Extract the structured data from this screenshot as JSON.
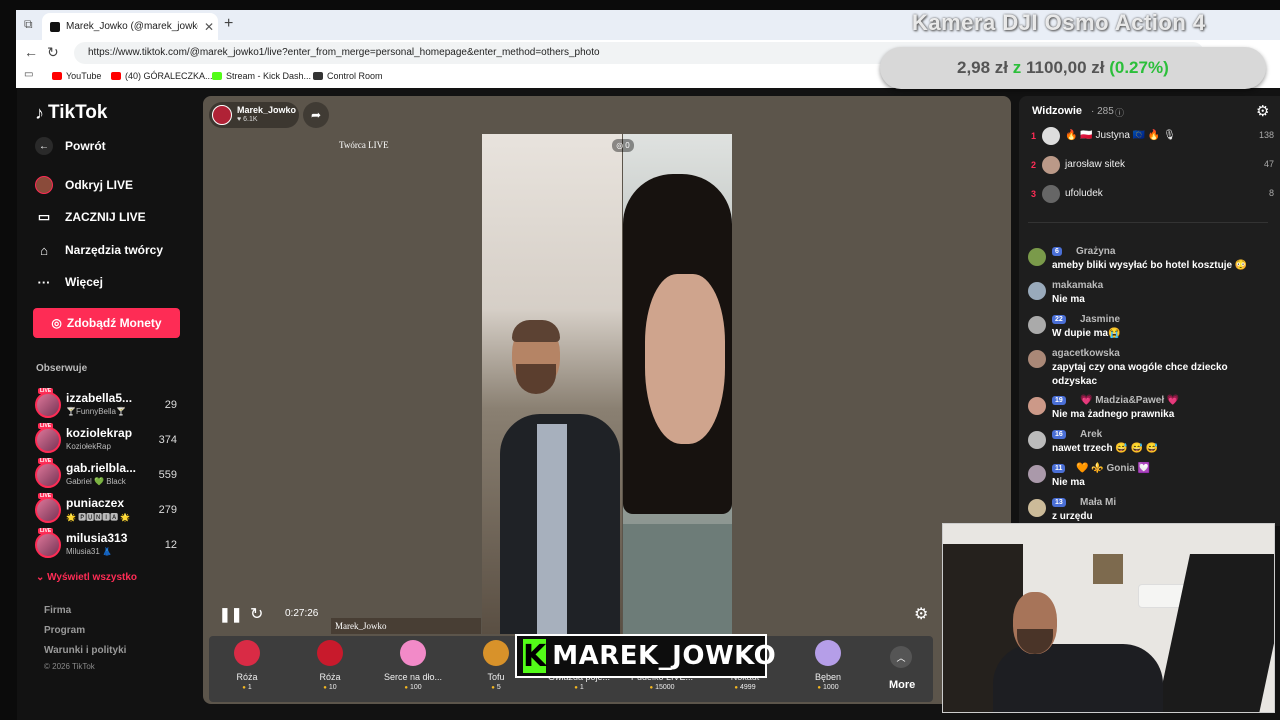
{
  "browser": {
    "tab_title": "Marek_Jowko (@marek_jowko1) p",
    "url": "https://www.tiktok.com/@marek_jowko1/live?enter_from_merge=personal_homepage&enter_method=others_photo",
    "bookmarks": [
      {
        "label": "YouTube",
        "color": "#ff0000"
      },
      {
        "label": "(40) GÓRALECZKA...",
        "color": "#ff0000"
      },
      {
        "label": "Stream - Kick Dash...",
        "color": "#53fc18"
      },
      {
        "label": "Control Room",
        "color": "#333333"
      }
    ]
  },
  "overlay": {
    "camera_title": "Kamera DJI Osmo Action 4",
    "price_current": "2,98 zł",
    "price_sep": "z",
    "price_goal": "1100,00 zł",
    "price_pct": "(0.27%)"
  },
  "sidebar": {
    "logo": "TikTok",
    "back_label": "Powrót",
    "nav": [
      {
        "label": "Odkryj LIVE",
        "icon": "avatar"
      },
      {
        "label": "ZACZNIJ LIVE",
        "icon": "camera-icon"
      },
      {
        "label": "Narzędzia twórcy",
        "icon": "home-icon"
      },
      {
        "label": "Więcej",
        "icon": "more-icon"
      }
    ],
    "coins_button": "Zdobądź Monety",
    "following_label": "Obserwuje",
    "following": [
      {
        "name": "izzabella5...",
        "sub": "🍸FunnyBella🍸",
        "count": "29"
      },
      {
        "name": "koziolekrap",
        "sub": "KoziołekRap",
        "count": "374"
      },
      {
        "name": "gab.rielbla...",
        "sub": "Gabriel 💚 Black",
        "count": "559"
      },
      {
        "name": "puniaczex",
        "sub": "🌟 🅿🆄🅽🅸🅰 🌟",
        "count": "279"
      },
      {
        "name": "milusia313",
        "sub": "Milusia31 👗",
        "count": "12"
      }
    ],
    "show_all": "Wyświetl wszystko",
    "footer_links": [
      "Firma",
      "Program",
      "Warunki i polityki"
    ],
    "copyright": "© 2026 TikTok"
  },
  "stream": {
    "host_name": "Marek_Jowko",
    "host_likes": "6.1K",
    "creator_tag": "Twórca LIVE",
    "split_count": "0",
    "timer": "0:27:26",
    "cohost_label": "Marek_Jowko",
    "kick_name": "MAREK_JOWKO",
    "gifts": [
      {
        "name": "Róża",
        "price": "1",
        "color": "#d92b45"
      },
      {
        "name": "Róża",
        "price": "10",
        "color": "#c81a2c"
      },
      {
        "name": "Serce na dło...",
        "price": "100",
        "color": "#f28ac8"
      },
      {
        "name": "Tofu",
        "price": "5",
        "color": "#d8922a"
      },
      {
        "name": "Gwiazda poje...",
        "price": "1",
        "color": "#f3d24a"
      },
      {
        "name": "Pudełko LIVE...",
        "price": "15000",
        "color": "#b04cd6"
      },
      {
        "name": "Nokaut",
        "price": "4999",
        "color": "#c0c0c0"
      },
      {
        "name": "Bęben",
        "price": "1000",
        "color": "#b59ee8"
      }
    ],
    "more_label": "More"
  },
  "right_panel": {
    "viewers_label": "Widzowie",
    "viewers_count": "· 285",
    "top_viewers": [
      {
        "rank": "1",
        "name": "🔥 🇵🇱 Justyna 🇪🇺 🔥 🎙",
        "score": "138"
      },
      {
        "rank": "2",
        "name": "jarosław sitek",
        "score": "47"
      },
      {
        "rank": "3",
        "name": "ufoludek",
        "score": "8"
      }
    ],
    "chat": [
      {
        "level": "6",
        "user": "Grażyna",
        "msg": "ameby bliki wysyłać bo hotel kosztuje 😳"
      },
      {
        "level": "",
        "user": "makamaka",
        "msg": "Nie ma"
      },
      {
        "level": "22",
        "user": "Jasmine",
        "msg": "W dupie ma😭"
      },
      {
        "level": "",
        "user": "agacetkowska",
        "msg": "zapytaj czy ona wogóle chce dziecko odzyskac"
      },
      {
        "level": "19",
        "user": "💗 Madzia&Paweł 💗",
        "msg": "Nie ma żadnego prawnika"
      },
      {
        "level": "16",
        "user": "Arek",
        "msg": "nawet trzech 😅 😅 😅"
      },
      {
        "level": "11",
        "user": "🧡 ⚜️ Gonia 💟",
        "msg": "Nie ma"
      },
      {
        "level": "13",
        "user": "Mała Mi",
        "msg": "z urzędu"
      }
    ]
  }
}
